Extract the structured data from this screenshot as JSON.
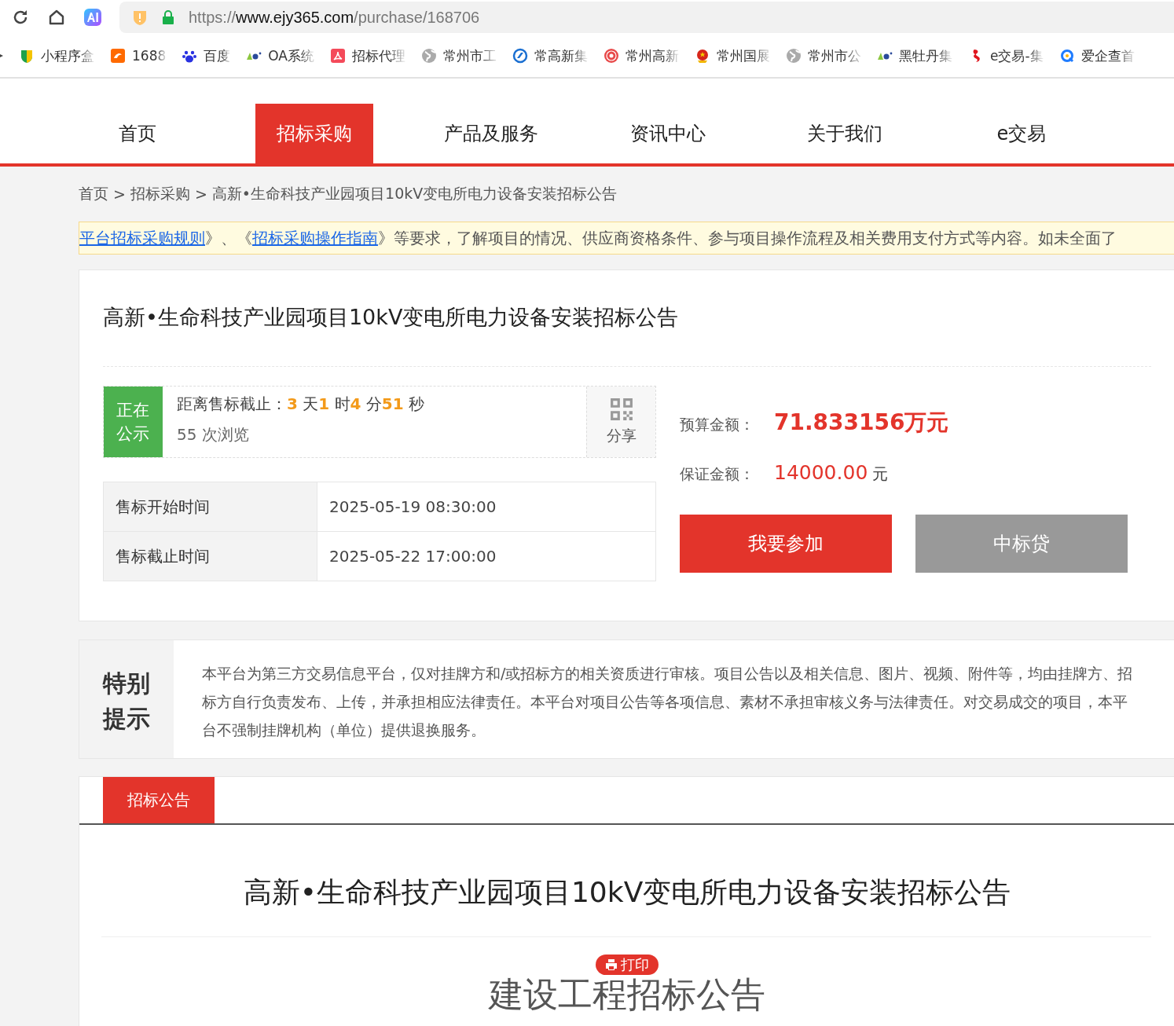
{
  "browser": {
    "url_scheme": "https://",
    "url_host": "www.ejy365.com",
    "url_path": "/purchase/168706",
    "bookmarks": [
      {
        "label": "小程序盒"
      },
      {
        "label": "1688"
      },
      {
        "label": "百度"
      },
      {
        "label": "OA系统"
      },
      {
        "label": "招标代理"
      },
      {
        "label": "常州市工"
      },
      {
        "label": "常高新集"
      },
      {
        "label": "常州高新"
      },
      {
        "label": "常州国展"
      },
      {
        "label": "常州市公"
      },
      {
        "label": "黑牡丹集"
      },
      {
        "label": "e交易-集"
      },
      {
        "label": "爱企查首"
      }
    ]
  },
  "nav": [
    {
      "label": "首页",
      "selected": false
    },
    {
      "label": "招标采购",
      "selected": true
    },
    {
      "label": "产品及服务",
      "selected": false
    },
    {
      "label": "资讯中心",
      "selected": false
    },
    {
      "label": "关于我们",
      "selected": false
    },
    {
      "label": "e交易",
      "selected": false
    }
  ],
  "breadcrumb": {
    "separator": ">",
    "items": [
      "首页",
      "招标采购",
      "高新•生命科技产业园项目10kV变电所电力设备安装招标公告"
    ]
  },
  "notice": [
    {
      "text": "平台招标采购规则",
      "link": true
    },
    {
      "text": "》、《",
      "link": false
    },
    {
      "text": "招标采购操作指南",
      "link": true
    },
    {
      "text": "》等要求，了解项目的情况、供应商资格条件、参与项目操作流程及相关费用支付方式等内容。如未全面了",
      "link": false
    }
  ],
  "project": {
    "title": "高新•生命科技产业园项目10kV变电所电力设备安装招标公告",
    "status": "正在公示",
    "countdown_label": "距离售标截止：",
    "countdown": [
      {
        "value": "3",
        "unit": "天"
      },
      {
        "value": "1",
        "unit": "时"
      },
      {
        "value": "4",
        "unit": "分"
      },
      {
        "value": "51",
        "unit": "秒"
      }
    ],
    "views": "55 次浏览",
    "share": "分享",
    "times": [
      {
        "label": "售标开始时间",
        "value": "2025-05-19 08:30:00"
      },
      {
        "label": "售标截止时间",
        "value": "2025-05-22 17:00:00"
      }
    ],
    "budget_label": "预算金额：",
    "budget": "71.833156万元",
    "deposit_label": "保证金额：",
    "deposit": "14000.00",
    "deposit_unit": "元",
    "buttons": [
      {
        "label": "我要参加",
        "kind": "primary"
      },
      {
        "label": "中标贷",
        "kind": "secondary"
      }
    ]
  },
  "special": {
    "title": "特别提示",
    "text": "本平台为第三方交易信息平台，仅对挂牌方和/或招标方的相关资质进行审核。项目公告以及相关信息、图片、视频、附件等，均由挂牌方、招标方自行负责发布、上传，并承担相应法律责任。本平台对项目公告等各项信息、素材不承担审核义务与法律责任。对交易成交的项目，本平台不强制挂牌机构（单位）提供退换服务。"
  },
  "tabs": [
    {
      "label": "招标公告",
      "selected": true
    }
  ],
  "article": {
    "title": "高新•生命科技产业园项目10kV变电所电力设备安装招标公告",
    "print": "打印",
    "heading": "建设工程招标公告"
  }
}
